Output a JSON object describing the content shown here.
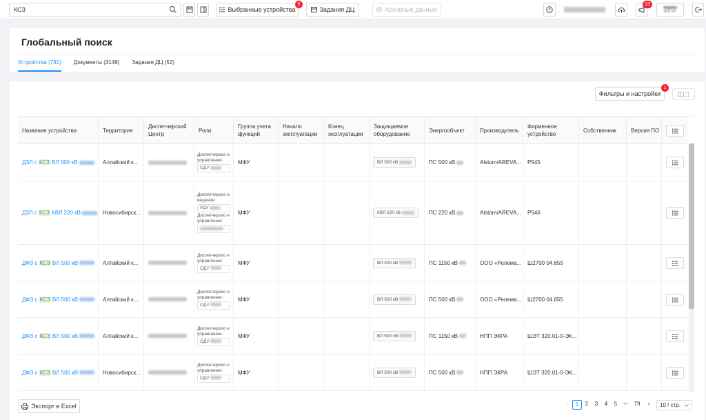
{
  "topbar": {
    "search_value": "КСЗ",
    "selected_devices_label": "Выбранные устройства",
    "selected_devices_badge": "5",
    "dc_tasks_label": "Задания ДЦ",
    "archive_label": "Архивные данные",
    "notifications_badge": "13",
    "user_role": "admin"
  },
  "page": {
    "title": "Глобальный поиск",
    "tabs": [
      {
        "label": "Устройства (781)"
      },
      {
        "label": "Документы (3149)"
      },
      {
        "label": "Задания ДЦ (52)"
      }
    ],
    "filters_label": "Фильтры и настройки",
    "filters_badge": "1"
  },
  "table": {
    "headers": [
      "Название устройства",
      "Территория",
      "Диспетчерский Центр",
      "Роли",
      "Группа учета функций",
      "Начало эксплуатации",
      "Конец эксплуатации",
      "Защищаемое оборудование",
      "Энергообъект",
      "Производитель",
      "Фирменное устройство",
      "Собственник",
      "Версия ПО"
    ],
    "rows": [
      {
        "name_pre": "ДЗЛ с ",
        "name_hl": "КСЗ",
        "name_post": " ВЛ 500 кВ",
        "territory": "Алтайский к...",
        "roles": [
          {
            "label": "Диспетчерско е управление:",
            "tag": "ОДУ"
          }
        ],
        "group": "МФУ",
        "equipment": "ВЛ 500 кВ",
        "object": "ПС 500 кВ",
        "vendor": "Alstom/AREVA...",
        "device": "P545"
      },
      {
        "name_pre": "ДЗЛ с ",
        "name_hl": "КСЗ",
        "name_post": " КВЛ 220 кВ",
        "territory": "Новосибирск...",
        "roles": [
          {
            "label": "Диспетчерско е ведение:",
            "tag": "РДУ"
          },
          {
            "label": "Диспетчерско е управление:",
            "tag": ""
          }
        ],
        "group": "МФУ",
        "equipment": "КВЛ 220 кВ",
        "object": "ПС 220 кВ",
        "vendor": "Alstom/AREVA...",
        "device": "P546"
      },
      {
        "name_pre": "ДФЗ с ",
        "name_hl": "КСЗ",
        "name_post": " ВЛ 500 кВ",
        "territory": "Алтайский к...",
        "roles": [
          {
            "label": "Диспетчерско е управление:",
            "tag": "ОДУ"
          }
        ],
        "group": "МФУ",
        "equipment": "ВЛ 500 кВ",
        "object": "ПС 1150 кВ",
        "vendor": "ООО «Релема...",
        "device": "Ш2700 04.655"
      },
      {
        "name_pre": "ДФЗ с ",
        "name_hl": "КСЗ",
        "name_post": " ВЛ 500 кВ",
        "territory": "Алтайский к...",
        "roles": [
          {
            "label": "Диспетчерско е управление:",
            "tag": "ОДУ"
          }
        ],
        "group": "МФУ",
        "equipment": "ВЛ 500 кВ",
        "object": "ПС 500 кВ",
        "vendor": "ООО «Релема...",
        "device": "Ш2700 04.655"
      },
      {
        "name_pre": "ДФЗ с ",
        "name_hl": "КСЗ",
        "name_post": " ВЛ 500 кВ",
        "territory": "Алтайский к...",
        "roles": [
          {
            "label": "Диспетчерско е управление:",
            "tag": "ОДУ"
          }
        ],
        "group": "МФУ",
        "equipment": "ВЛ 500 кВ",
        "object": "ПС 1150 кВ",
        "vendor": "НПП ЭКРА",
        "device": "ШЭТ 320.01-0-ЭК..."
      },
      {
        "name_pre": "ДФЗ с ",
        "name_hl": "КСЗ",
        "name_post": " ВЛ 500 кВ",
        "territory": "Новосибирск...",
        "roles": [
          {
            "label": "Диспетчерско е управление:",
            "tag": "ОДУ"
          }
        ],
        "group": "МФУ",
        "equipment": "ВЛ 500 кВ",
        "object": "ПС 500 кВ",
        "vendor": "НПП ЭКРА",
        "device": "ШЭТ 320.01-0-ЭК..."
      }
    ]
  },
  "footer": {
    "export_label": "Экспорт в Excel",
    "pages": [
      "1",
      "2",
      "3",
      "4",
      "5",
      "•••",
      "79"
    ],
    "page_size": "10 / стр."
  }
}
